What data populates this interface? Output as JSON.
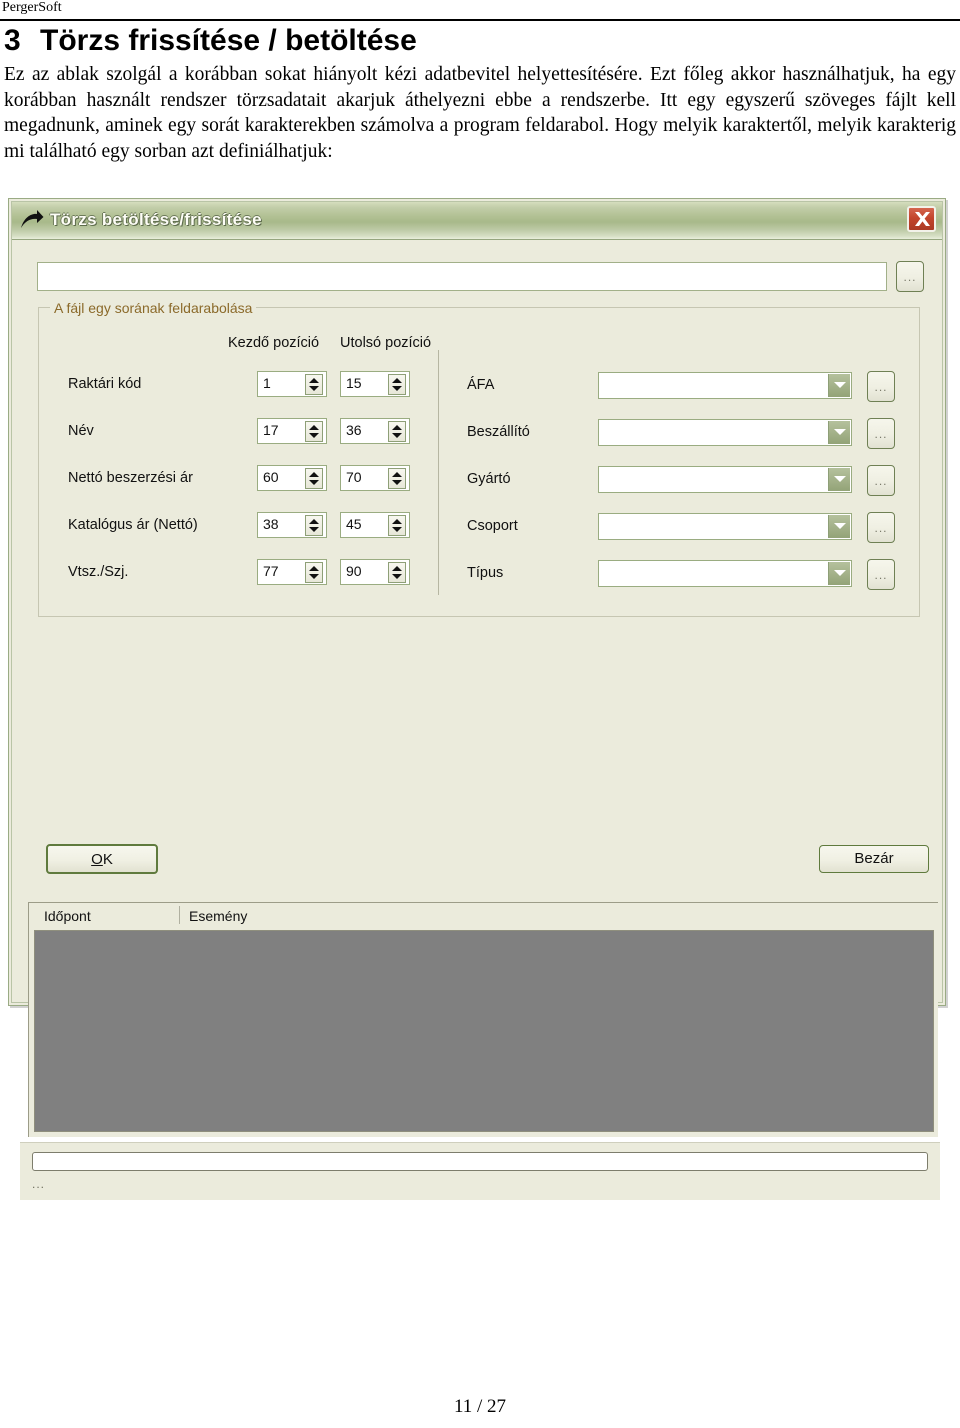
{
  "page": {
    "header": "PergerSoft",
    "heading_number": "3",
    "heading_text": "Törzs frissítése / betöltése",
    "paragraph": "Ez az ablak szolgál a korábban sokat hiányolt kézi adatbevitel helyettesítésére. Ezt főleg akkor használhatjuk, ha egy korábban használt rendszer törzsadatait akarjuk áthelyezni ebbe a rendszerbe. Itt egy egyszerű szöveges fájlt kell megadnunk, aminek egy sorát karakterekben számolva a program feldarabol. Hogy melyik karaktertől, melyik karakterig mi található egy sorban azt definiálhatjuk:",
    "footer": "11 / 27"
  },
  "dialog": {
    "title": "Törzs betöltése/frissítése",
    "title_icon": "curved-arrow-icon",
    "close_icon": "close-icon",
    "file": {
      "value": "",
      "placeholder": "",
      "browse_label": "..."
    },
    "groupbox": {
      "title": "A fájl egy sorának feldarabolása",
      "columns": {
        "start": "Kezdő pozíció",
        "end": "Utolsó pozíció"
      },
      "rows": [
        {
          "label": "Raktári kód",
          "start": "1",
          "end": "15"
        },
        {
          "label": "Név",
          "start": "17",
          "end": "36"
        },
        {
          "label": "Nettó beszerzési ár",
          "start": "60",
          "end": "70"
        },
        {
          "label": "Katalógus ár (Nettó)",
          "start": "38",
          "end": "45"
        },
        {
          "label": "Vtsz./Szj.",
          "start": "77",
          "end": "90"
        }
      ],
      "combos": [
        {
          "label": "ÁFA",
          "value": "",
          "browse_label": "..."
        },
        {
          "label": "Beszállító",
          "value": "",
          "browse_label": "..."
        },
        {
          "label": "Gyártó",
          "value": "",
          "browse_label": "..."
        },
        {
          "label": "Csoport",
          "value": "",
          "browse_label": "..."
        },
        {
          "label": "Típus",
          "value": "",
          "browse_label": "..."
        }
      ]
    },
    "buttons": {
      "ok": "OK",
      "ok_accel": "O",
      "ok_rest": "K",
      "close": "Bezár"
    },
    "log": {
      "col_time": "Időpont",
      "col_event": "Esemény",
      "rows": []
    },
    "status": {
      "progress_value": "",
      "text": "..."
    }
  },
  "colors": {
    "titlebar_green": "#a8b98a",
    "dialog_face": "#ebebdc",
    "close_red": "#c3452c",
    "group_title": "#8b6a2a",
    "log_body": "#808080"
  }
}
